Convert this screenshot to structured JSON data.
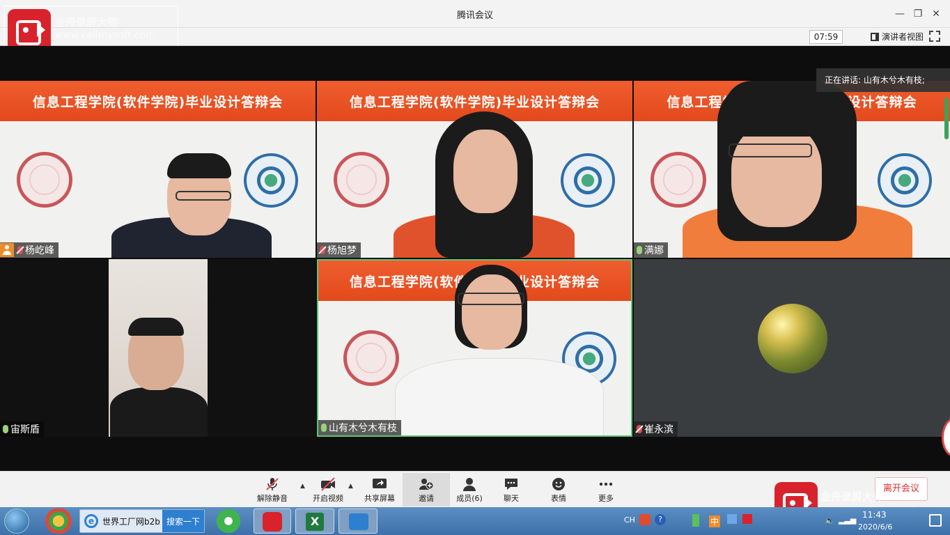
{
  "window": {
    "title": "腾讯会议",
    "timer": "07:59",
    "presenter_view": "演讲者视图"
  },
  "watermark": {
    "brand": "金舟录屏大师",
    "url": "www.callmysoft.com"
  },
  "speaking": "正在讲话: 山有木兮木有枝;",
  "banner_text": "信息工程学院(软件学院)毕业设计答辩会",
  "participants": [
    {
      "name": "杨屹峰",
      "mic": "off",
      "host": true
    },
    {
      "name": "杨旭梦",
      "mic": "off",
      "host": false
    },
    {
      "name": "满娜",
      "mic": "on",
      "host": false
    },
    {
      "name": "宙斯盾",
      "mic": "on",
      "host": false
    },
    {
      "name": "山有木兮木有枝",
      "mic": "on",
      "host": false
    },
    {
      "name": "崔永滨",
      "mic": "off",
      "host": false
    }
  ],
  "toolbar": {
    "unmute": "解除静音",
    "video": "开启视频",
    "share": "共享屏幕",
    "invite": "邀请",
    "members": "成员(6)",
    "chat": "聊天",
    "reaction": "表情",
    "more": "更多",
    "leave": "离开会议"
  },
  "taskbar": {
    "ie_label": "世界工厂网b2b",
    "ie_search": "搜索一下",
    "lang": "CH",
    "ime": "中",
    "time": "11:43",
    "date": "2020/6/6"
  },
  "colors": {
    "banner": "#e24a1c",
    "active_speaker_border": "#5cc77a",
    "leave_text": "#e02e2e"
  }
}
